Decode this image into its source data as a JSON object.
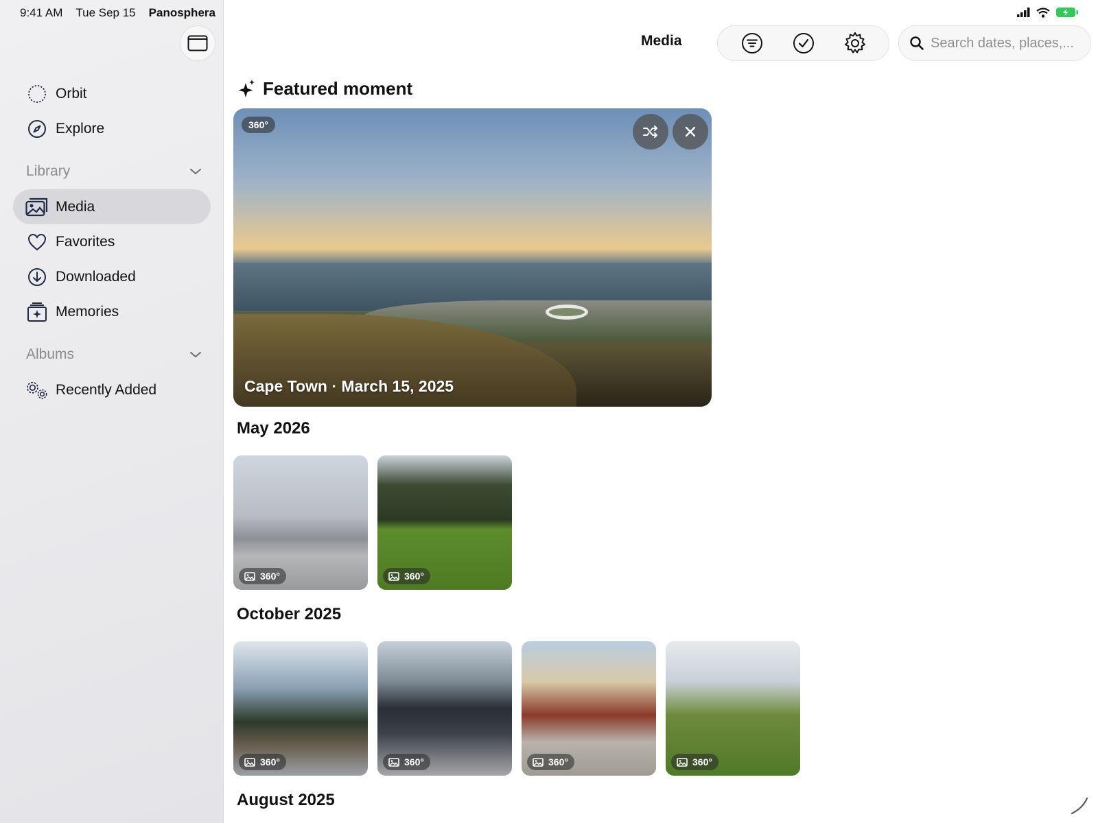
{
  "status_bar": {
    "time": "9:41 AM",
    "date": "Tue Sep 15",
    "app": "Panosphera"
  },
  "sidebar": {
    "top_items": [
      {
        "label": "Orbit",
        "icon": "orbit-icon"
      },
      {
        "label": "Explore",
        "icon": "compass-icon"
      }
    ],
    "library_heading": "Library",
    "library_items": [
      {
        "label": "Media",
        "icon": "photo-stack-icon",
        "active": true
      },
      {
        "label": "Favorites",
        "icon": "heart-icon"
      },
      {
        "label": "Downloaded",
        "icon": "download-icon"
      },
      {
        "label": "Memories",
        "icon": "memories-icon"
      }
    ],
    "albums_heading": "Albums",
    "album_items": [
      {
        "label": "Recently Added",
        "icon": "gears-icon"
      }
    ]
  },
  "header": {
    "title": "Media",
    "search_placeholder": "Search dates, places,..."
  },
  "featured": {
    "heading": "Featured moment",
    "badge": "360°",
    "caption": "Cape Town · March 15, 2025"
  },
  "sections": [
    {
      "title": "May 2026",
      "items": [
        {
          "tag": "360°"
        },
        {
          "tag": "360°"
        }
      ]
    },
    {
      "title": "October 2025",
      "items": [
        {
          "tag": "360°"
        },
        {
          "tag": "360°"
        },
        {
          "tag": "360°"
        },
        {
          "tag": "360°"
        }
      ]
    },
    {
      "title": "August 2025"
    }
  ],
  "colors": {
    "accent": "#1f2a44",
    "sidebar_bg": "#ececef",
    "active_item": "#d8d8dc",
    "battery": "#34c759"
  }
}
